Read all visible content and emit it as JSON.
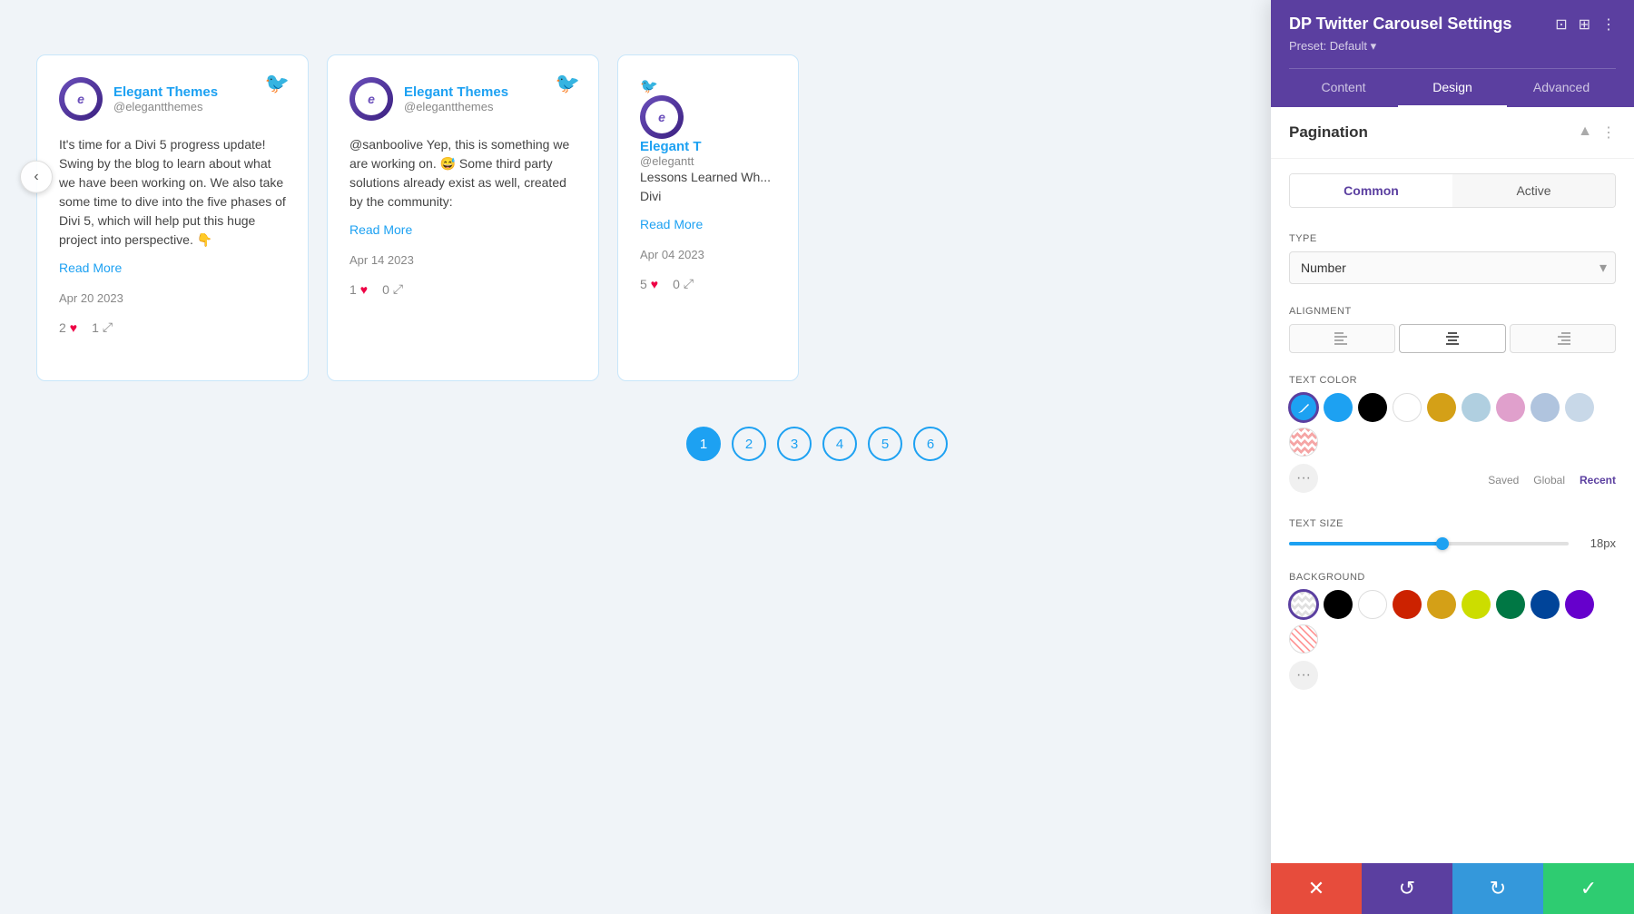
{
  "panel": {
    "title": "DP Twitter Carousel Settings",
    "preset_label": "Preset: Default",
    "preset_arrow": "▾",
    "tabs": [
      {
        "label": "Content",
        "active": false
      },
      {
        "label": "Design",
        "active": true
      },
      {
        "label": "Advanced",
        "active": false
      }
    ],
    "section": {
      "title": "Pagination",
      "collapse_icon": "▲",
      "more_icon": "⋮"
    },
    "sub_tabs": [
      {
        "label": "Common",
        "active": true
      },
      {
        "label": "Active",
        "active": false
      }
    ],
    "type_label": "TYPE",
    "type_value": "Number",
    "alignment_label": "ALIGNMENT",
    "alignment_options": [
      "left",
      "center",
      "right"
    ],
    "text_color_label": "Text Color",
    "text_size_label": "Text Size",
    "text_size_value": "18px",
    "text_size_percent": 55,
    "background_label": "Background",
    "color_labels": {
      "saved": "Saved",
      "global": "Global",
      "recent": "Recent"
    }
  },
  "cards": [
    {
      "username": "Elegant Themes",
      "handle": "@elegantthemes",
      "text": "It's time for a Divi 5 progress update! Swing by the blog to learn about what we have been working on. We also take some time to dive into the five phases of Divi 5, which will help put this huge project into perspective. 👇",
      "read_more": "Read More",
      "date": "Apr 20 2023",
      "likes": "2",
      "shares": "1"
    },
    {
      "username": "Elegant Themes",
      "handle": "@elegantthemes",
      "text": "@sanboolive Yep, this is something we are working on. 😅 Some third party solutions already exist as well, created by the community:",
      "read_more": "Read More",
      "date": "Apr 14 2023",
      "likes": "1",
      "shares": "0"
    },
    {
      "username": "Elegant T",
      "handle": "@elegantt",
      "text": "Lessons Learned Wh... Divi",
      "read_more": "Read More",
      "date": "Apr 04 2023",
      "likes": "5",
      "shares": "0"
    }
  ],
  "pagination": {
    "pages": [
      "1",
      "2",
      "3",
      "4",
      "5",
      "6"
    ],
    "active_page": "1"
  },
  "toolbar": {
    "cancel_icon": "✕",
    "undo_icon": "↺",
    "redo_icon": "↻",
    "save_icon": "✓"
  }
}
